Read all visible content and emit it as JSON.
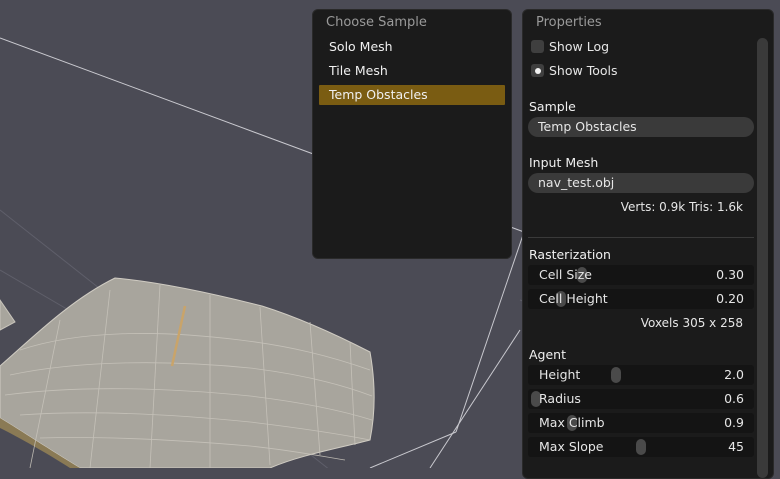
{
  "choose_sample": {
    "title": "Choose Sample",
    "options": [
      "Solo Mesh",
      "Tile Mesh",
      "Temp Obstacles"
    ],
    "selected": "Temp Obstacles"
  },
  "properties": {
    "title": "Properties",
    "show_log": {
      "label": "Show Log",
      "checked": false
    },
    "show_tools": {
      "label": "Show Tools",
      "checked": true
    },
    "sample": {
      "heading": "Sample",
      "value": "Temp Obstacles"
    },
    "input_mesh": {
      "heading": "Input Mesh",
      "value": "nav_test.obj",
      "stats": "Verts: 0.9k  Tris: 1.6k"
    },
    "rasterization": {
      "heading": "Rasterization",
      "cell_size": {
        "label": "Cell Size",
        "value": "0.30",
        "level": 0.22
      },
      "cell_height": {
        "label": "Cell Height",
        "value": "0.20",
        "level": 0.12
      },
      "voxels": "Voxels  305 x 258"
    },
    "agent": {
      "heading": "Agent",
      "height": {
        "label": "Height",
        "value": "2.0",
        "level": 0.38
      },
      "radius": {
        "label": "Radius",
        "value": "0.6",
        "level": 0.0
      },
      "max_climb": {
        "label": "Max Climb",
        "value": "0.9",
        "level": 0.17
      },
      "max_slope": {
        "label": "Max Slope",
        "value": "45",
        "level": 0.5
      }
    }
  },
  "colors": {
    "background": "#4b4b55",
    "selection": "#7a5c12",
    "terrain": "#a8a59d",
    "grid_line": "#c9c9cf"
  }
}
